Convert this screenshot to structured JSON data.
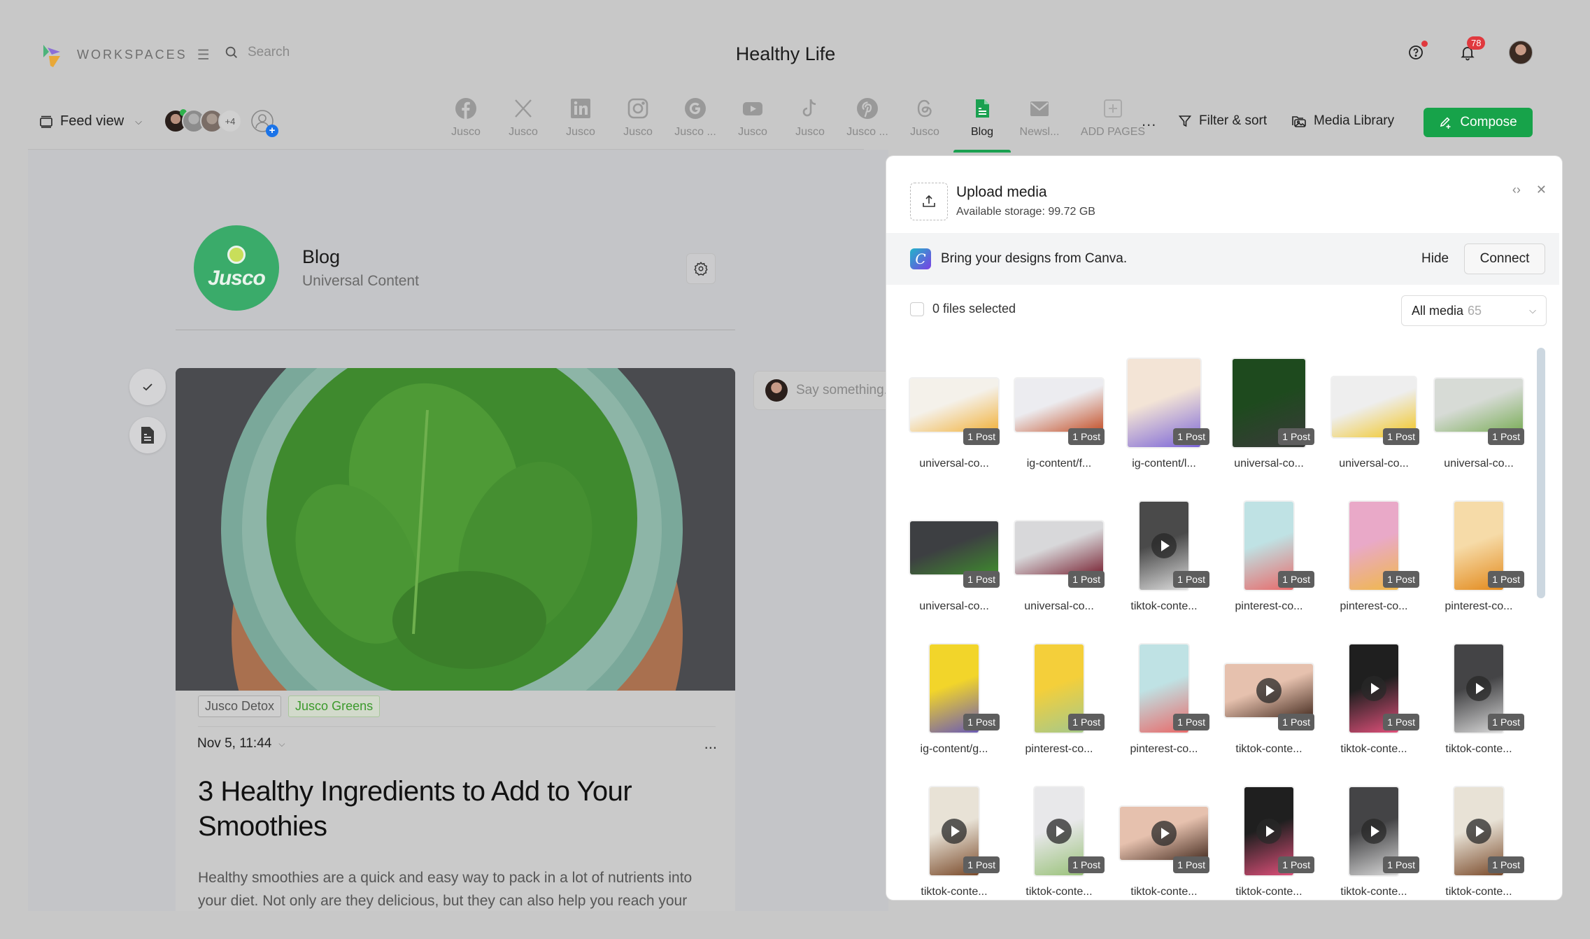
{
  "topbar": {
    "workspaces_label": "WORKSPACES",
    "search_placeholder": "Search",
    "app_title": "Healthy Life",
    "notifications_count": "78"
  },
  "toolbar": {
    "feed_view_label": "Feed view",
    "members_more": "+4",
    "channels": [
      {
        "icon": "facebook-icon",
        "label": "Jusco"
      },
      {
        "icon": "x-icon",
        "label": "Jusco"
      },
      {
        "icon": "linkedin-icon",
        "label": "Jusco"
      },
      {
        "icon": "instagram-icon",
        "label": "Jusco"
      },
      {
        "icon": "google-icon",
        "label": "Jusco ..."
      },
      {
        "icon": "youtube-icon",
        "label": "Jusco"
      },
      {
        "icon": "tiktok-icon",
        "label": "Jusco"
      },
      {
        "icon": "pinterest-icon",
        "label": "Jusco ..."
      },
      {
        "icon": "threads-icon",
        "label": "Jusco"
      },
      {
        "icon": "blog-icon",
        "label": "Blog",
        "active": true
      },
      {
        "icon": "newsletter-icon",
        "label": "Newsl..."
      },
      {
        "icon": "add-page-icon",
        "label": "ADD PAGES"
      }
    ],
    "more_label": "...",
    "filter_label": "Filter & sort",
    "media_library_label": "Media Library",
    "compose_label": "Compose",
    "accent_color": "#17a34a"
  },
  "page": {
    "avatar_brand": "Jusco",
    "name": "Blog",
    "subtitle": "Universal Content"
  },
  "post": {
    "tags": [
      {
        "label": "Jusco Detox",
        "style": "default"
      },
      {
        "label": "Jusco Greens",
        "style": "green"
      }
    ],
    "date": "Nov 5, 11:44",
    "more_label": "...",
    "title": "3 Healthy Ingredients to Add to Your Smoothies",
    "body": "Healthy smoothies are a quick and easy way to pack in a lot of nutrients into your diet. Not only are they delicious, but they can also help you reach your"
  },
  "comment": {
    "placeholder": "Say something..."
  },
  "media_panel": {
    "upload_title": "Upload media",
    "storage_text": "Available storage: 99.72 GB",
    "canva_text": "Bring your designs from Canva.",
    "hide_label": "Hide",
    "connect_label": "Connect",
    "selected_text": "0 files selected",
    "filter_label": "All media",
    "filter_count": "65",
    "items": [
      {
        "label": "universal-co...",
        "posts": "1 Post",
        "shape": "land",
        "video": false,
        "colors": [
          "#f4f1ea",
          "#f2b23d"
        ]
      },
      {
        "label": "ig-content/f...",
        "posts": "1 Post",
        "shape": "land",
        "video": false,
        "colors": [
          "#ececf0",
          "#c4512a"
        ]
      },
      {
        "label": "ig-content/l...",
        "posts": "1 Post",
        "shape": "port",
        "video": false,
        "colors": [
          "#f3e4d6",
          "#7a64d8"
        ]
      },
      {
        "label": "universal-co...",
        "posts": "1 Post",
        "shape": "port",
        "video": false,
        "colors": [
          "#1e4a1e",
          "#3a3a3a"
        ]
      },
      {
        "label": "universal-co...",
        "posts": "1 Post",
        "shape": "sq",
        "video": false,
        "colors": [
          "#eeeeee",
          "#f2c51e"
        ]
      },
      {
        "label": "universal-co...",
        "posts": "1 Post",
        "shape": "land",
        "video": false,
        "colors": [
          "#d7dbd6",
          "#7cae5a"
        ]
      },
      {
        "label": "universal-co...",
        "posts": "1 Post",
        "shape": "land",
        "video": false,
        "colors": [
          "#3d3f42",
          "#3f8a2e"
        ]
      },
      {
        "label": "universal-co...",
        "posts": "1 Post",
        "shape": "land",
        "video": false,
        "colors": [
          "#d8d8da",
          "#7a2636"
        ]
      },
      {
        "label": "tiktok-conte...",
        "posts": "1 Post",
        "shape": "tall",
        "video": true,
        "colors": [
          "#4a4a4a",
          "#dcdcdc"
        ]
      },
      {
        "label": "pinterest-co...",
        "posts": "1 Post",
        "shape": "tall",
        "video": false,
        "colors": [
          "#bfe2e4",
          "#e86a6a"
        ]
      },
      {
        "label": "pinterest-co...",
        "posts": "1 Post",
        "shape": "tall",
        "video": false,
        "colors": [
          "#e9a9c8",
          "#f0b84a"
        ]
      },
      {
        "label": "pinterest-co...",
        "posts": "1 Post",
        "shape": "tall",
        "video": false,
        "colors": [
          "#f6dba8",
          "#e38a1c"
        ]
      },
      {
        "label": "ig-content/g...",
        "posts": "1 Post",
        "shape": "tall",
        "video": false,
        "colors": [
          "#f2d52a",
          "#6b5bb4"
        ]
      },
      {
        "label": "pinterest-co...",
        "posts": "1 Post",
        "shape": "tall",
        "video": false,
        "colors": [
          "#f4cf3a",
          "#a6c98a"
        ]
      },
      {
        "label": "pinterest-co...",
        "posts": "1 Post",
        "shape": "tall",
        "video": false,
        "colors": [
          "#bfe2e4",
          "#e86a6a"
        ]
      },
      {
        "label": "tiktok-conte...",
        "posts": "1 Post",
        "shape": "land",
        "video": true,
        "colors": [
          "#e6c1ae",
          "#4a3024"
        ]
      },
      {
        "label": "tiktok-conte...",
        "posts": "1 Post",
        "shape": "tall",
        "video": true,
        "colors": [
          "#1f1f1f",
          "#e0507a"
        ]
      },
      {
        "label": "tiktok-conte...",
        "posts": "1 Post",
        "shape": "tall",
        "video": true,
        "colors": [
          "#444446",
          "#d8d8d8"
        ]
      },
      {
        "label": "tiktok-conte...",
        "posts": "1 Post",
        "shape": "tall",
        "video": true,
        "colors": [
          "#e8e2d6",
          "#7a4a2a"
        ]
      },
      {
        "label": "tiktok-conte...",
        "posts": "1 Post",
        "shape": "tall",
        "video": true,
        "colors": [
          "#e8e8ea",
          "#9ac27a"
        ]
      },
      {
        "label": "tiktok-conte...",
        "posts": "1 Post",
        "shape": "land",
        "video": true,
        "colors": [
          "#e6c1ae",
          "#4a3024"
        ]
      },
      {
        "label": "tiktok-conte...",
        "posts": "1 Post",
        "shape": "tall",
        "video": true,
        "colors": [
          "#1f1f1f",
          "#e0507a"
        ]
      },
      {
        "label": "tiktok-conte...",
        "posts": "1 Post",
        "shape": "tall",
        "video": true,
        "colors": [
          "#444446",
          "#d8d8d8"
        ]
      },
      {
        "label": "tiktok-conte...",
        "posts": "1 Post",
        "shape": "tall",
        "video": true,
        "colors": [
          "#e8e2d6",
          "#7a4a2a"
        ]
      }
    ]
  }
}
